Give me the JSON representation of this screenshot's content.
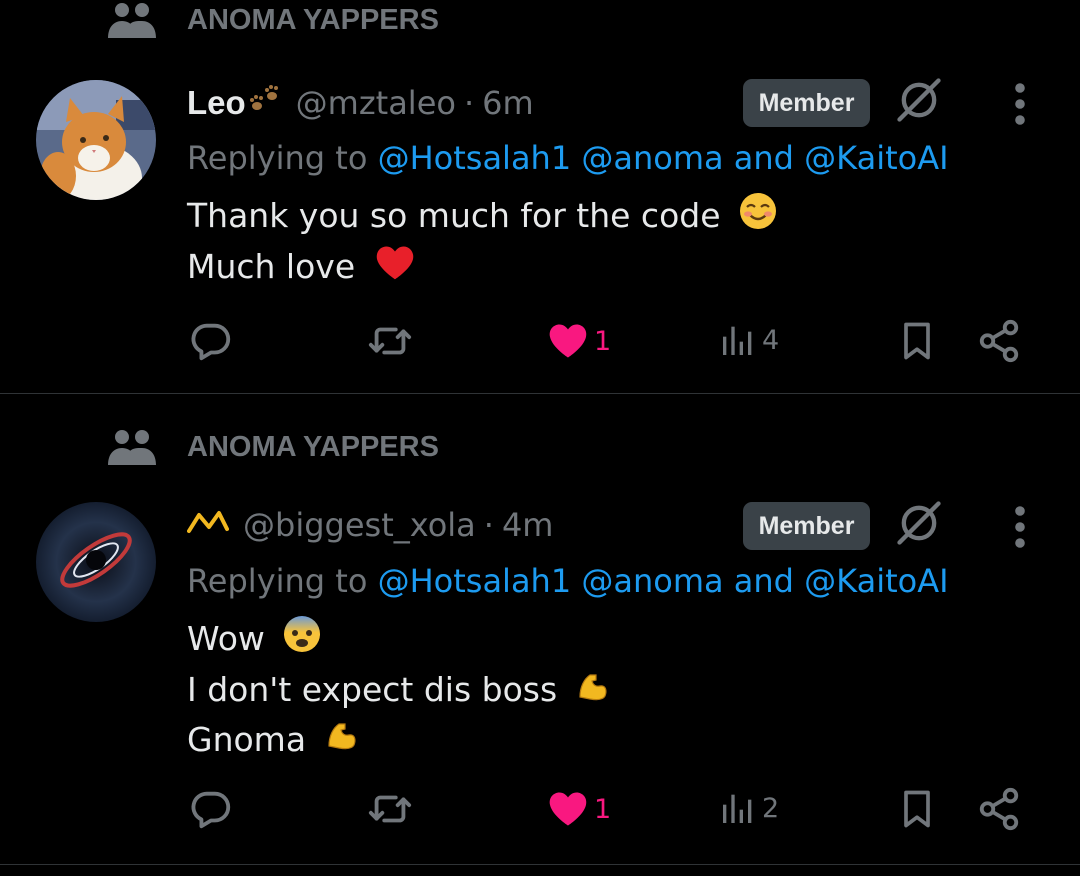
{
  "posts": [
    {
      "community": "ANOMA YAPPERS",
      "display_name": "Leo",
      "name_emoji": "paw-prints-emoji",
      "handle": "@mztaleo",
      "separator": "·",
      "time": "6m",
      "badge": "Member",
      "reply_prefix": "Replying to",
      "mentions": [
        "@Hotsalah1",
        "@anoma"
      ],
      "reply_and": "and",
      "mention_last": "@KaitoAI",
      "lines": [
        "Thank you so much for the code",
        "Much love"
      ],
      "line_emojis": [
        "smiling-blush-emoji",
        "red-heart-emoji"
      ],
      "likes": "1",
      "views": "4"
    },
    {
      "community": "ANOMA YAPPERS",
      "display_name": "",
      "name_emoji": "chart-increasing-emoji",
      "handle": "@biggest_xola",
      "separator": "·",
      "time": "4m",
      "badge": "Member",
      "reply_prefix": "Replying to",
      "mentions": [
        "@Hotsalah1",
        "@anoma"
      ],
      "reply_and": "and",
      "mention_last": "@KaitoAI",
      "lines": [
        "Wow",
        "I don't expect dis boss",
        "Gnoma"
      ],
      "line_emojis": [
        "fearful-face-emoji",
        "flexed-biceps-emoji",
        "flexed-biceps-emoji"
      ],
      "likes": "1",
      "views": "2"
    }
  ],
  "colors": {
    "background": "#000000",
    "text": "#e7e9ea",
    "muted": "#71767b",
    "link": "#1d9bf0",
    "like": "#f91880",
    "badge_bg": "#3a4248",
    "divider": "#2f3336"
  }
}
